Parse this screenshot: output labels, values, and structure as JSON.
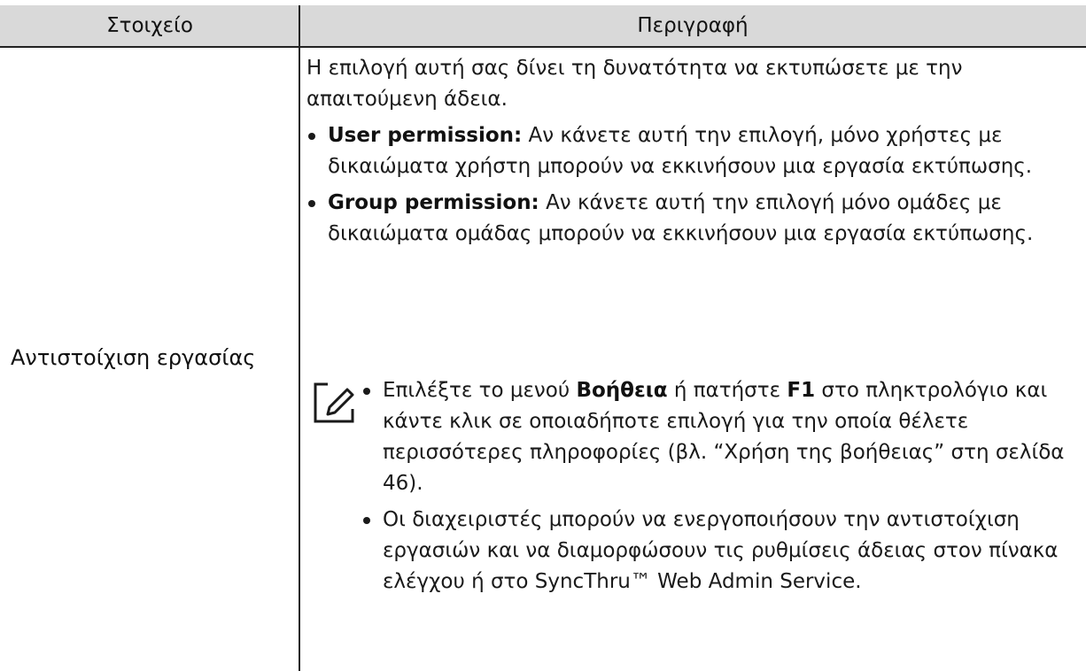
{
  "table": {
    "headers": {
      "item": "Στοιχείο",
      "description": "Περιγραφή"
    },
    "row": {
      "item": "Αντιστοίχιση εργασίας",
      "intro": "Η επιλογή αυτή σας δίνει τη δυνατότητα να εκτυπώσετε με την απαιτούμενη άδεια.",
      "options": [
        {
          "term": "User permission:",
          "text": " Αν κάνετε αυτή την επιλογή, μόνο χρήστες με δικαιώματα χρήστη μπορούν να εκκινήσουν μια εργασία εκτύπωσης."
        },
        {
          "term": "Group permission:",
          "text": " Αν κάνετε αυτή την επιλογή μόνο ομάδες με δικαιώματα ομάδας μπορούν να εκκινήσουν μια εργασία εκτύπωσης."
        }
      ],
      "note": {
        "icon": "note-pencil-icon",
        "item1": {
          "part1": "Επιλέξτε το μενού ",
          "bold1": "Βοήθεια",
          "part2": " ή πατήστε ",
          "bold2": "F1",
          "part3": " στο πληκτρολόγιο και κάντε κλικ σε οποιαδήποτε επιλογή για την οποία θέλετε περισσότερες πληροφορίες (βλ. “Χρήση της βοήθειας” στη σελίδα 46)."
        },
        "item2": "Οι διαχειριστές μπορούν να ενεργοποιήσουν την αντιστοίχιση εργασιών και να διαμορφώσουν τις ρυθμίσεις άδειας στον πίνακα ελέγχου ή στο SyncThru™ Web Admin Service."
      }
    }
  }
}
